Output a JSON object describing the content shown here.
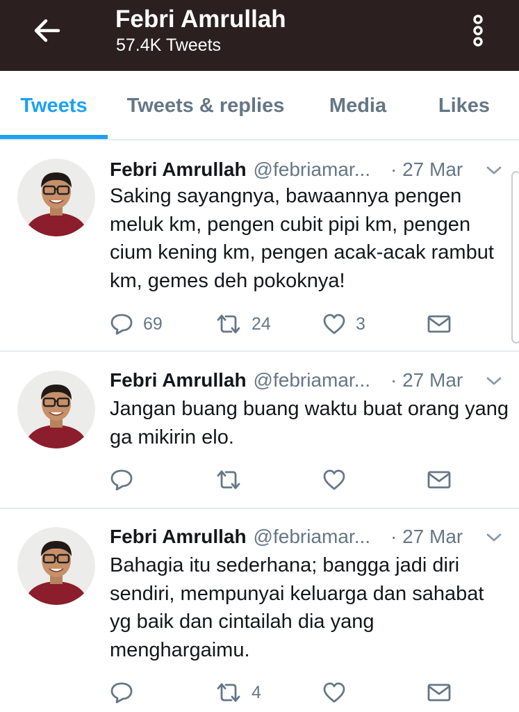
{
  "header": {
    "title": "Febri Amrullah",
    "subtitle": "57.4K Tweets"
  },
  "tabs": [
    {
      "label": "Tweets",
      "active": true
    },
    {
      "label": "Tweets & replies",
      "active": false
    },
    {
      "label": "Media",
      "active": false
    },
    {
      "label": "Likes",
      "active": false
    }
  ],
  "colors": {
    "header_bg": "#2b201f",
    "accent": "#1da1f2",
    "secondary_text": "#657786",
    "divider": "#e6ecf0"
  },
  "tweets": [
    {
      "author": "Febri Amrullah",
      "handle": "@febriamar...",
      "date": "· 27 Mar",
      "text": "Saking sayangnya, bawaannya pengen meluk km, pengen cubit pipi km, pengen cium kening km, pengen acak-acak rambut km, gemes deh pokoknya!",
      "replies": "69",
      "retweets": "24",
      "likes": "3"
    },
    {
      "author": "Febri Amrullah",
      "handle": "@febriamar...",
      "date": "· 27 Mar",
      "text": "Jangan buang buang waktu buat orang yang ga mikirin elo.",
      "replies": "",
      "retweets": "",
      "likes": ""
    },
    {
      "author": "Febri Amrullah",
      "handle": "@febriamar...",
      "date": "· 27 Mar",
      "text": "Bahagia itu sederhana; bangga jadi diri sendiri, mempunyai keluarga dan sahabat yg baik dan cintailah dia yang menghargaimu.",
      "replies": "",
      "retweets": "4",
      "likes": ""
    }
  ],
  "icons": {
    "back": "arrow-left-icon",
    "more": "vertical-dots-icon",
    "reply": "reply-bubble-icon",
    "retweet": "retweet-icon",
    "like": "heart-icon",
    "dm": "envelope-icon",
    "caret": "chevron-down-icon"
  }
}
